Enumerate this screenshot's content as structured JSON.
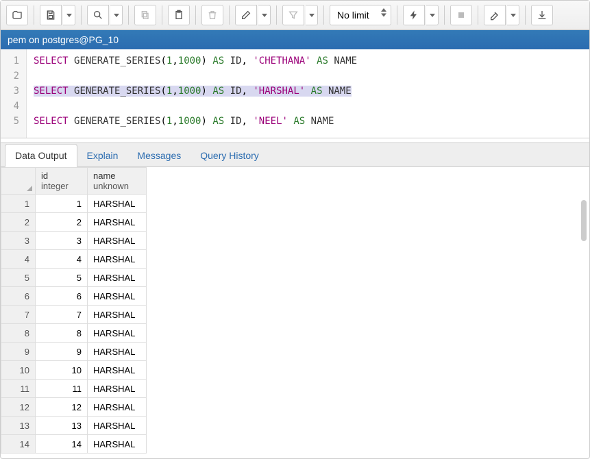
{
  "connection": {
    "label": "pem on postgres@PG_10"
  },
  "toolbar": {
    "limit_label": "No limit"
  },
  "editor": {
    "lines": [
      "1",
      "2",
      "3",
      "4",
      "5"
    ],
    "q1": {
      "keyword": "SELECT",
      "fn": "GENERATE_SERIES",
      "args": "(1,1000)",
      "as": "AS",
      "id": "ID",
      "comma": ", ",
      "str": "'CHETHANA'",
      "as2": "AS",
      "name": "NAME"
    },
    "q2": {
      "keyword": "SELECT",
      "fn": "GENERATE_SERIES",
      "args": "(1,1000)",
      "as": "AS",
      "id": "ID",
      "comma": ", ",
      "str": "'HARSHAL'",
      "as2": "AS",
      "name": "NAME"
    },
    "q3": {
      "keyword": "SELECT",
      "fn": "GENERATE_SERIES",
      "args": "(1,1000)",
      "as": "AS",
      "id": "ID",
      "comma": ", ",
      "str": "'NEEL'",
      "as2": "AS",
      "name": "NAME"
    }
  },
  "tabs": {
    "data_output": "Data Output",
    "explain": "Explain",
    "messages": "Messages",
    "query_history": "Query History"
  },
  "grid": {
    "columns": [
      {
        "name": "id",
        "type": "integer"
      },
      {
        "name": "name",
        "type": "unknown"
      }
    ],
    "rows": [
      {
        "n": "1",
        "id": "1",
        "name": "HARSHAL"
      },
      {
        "n": "2",
        "id": "2",
        "name": "HARSHAL"
      },
      {
        "n": "3",
        "id": "3",
        "name": "HARSHAL"
      },
      {
        "n": "4",
        "id": "4",
        "name": "HARSHAL"
      },
      {
        "n": "5",
        "id": "5",
        "name": "HARSHAL"
      },
      {
        "n": "6",
        "id": "6",
        "name": "HARSHAL"
      },
      {
        "n": "7",
        "id": "7",
        "name": "HARSHAL"
      },
      {
        "n": "8",
        "id": "8",
        "name": "HARSHAL"
      },
      {
        "n": "9",
        "id": "9",
        "name": "HARSHAL"
      },
      {
        "n": "10",
        "id": "10",
        "name": "HARSHAL"
      },
      {
        "n": "11",
        "id": "11",
        "name": "HARSHAL"
      },
      {
        "n": "12",
        "id": "12",
        "name": "HARSHAL"
      },
      {
        "n": "13",
        "id": "13",
        "name": "HARSHAL"
      },
      {
        "n": "14",
        "id": "14",
        "name": "HARSHAL"
      }
    ]
  }
}
